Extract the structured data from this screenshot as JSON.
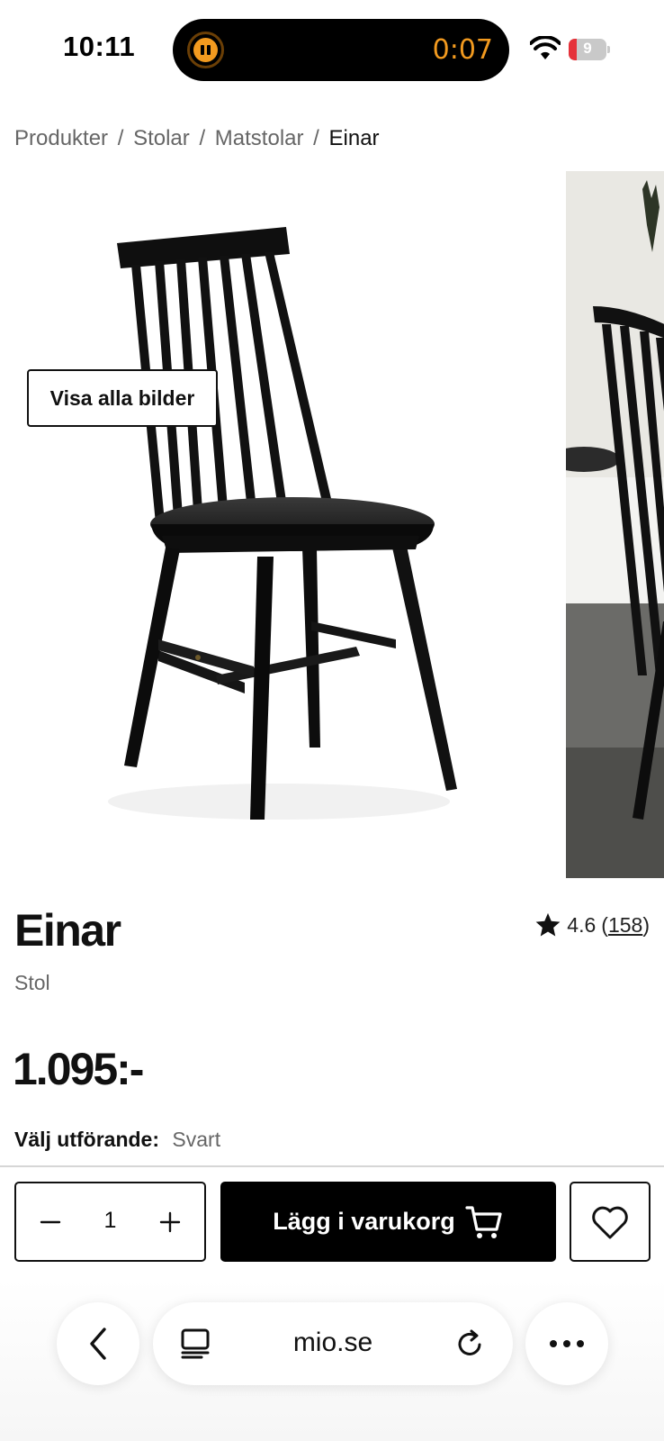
{
  "status_bar": {
    "time": "10:11",
    "timer": "0:07",
    "battery_level": "9",
    "icons": [
      "pause-icon",
      "wifi-icon",
      "battery-icon"
    ],
    "timer_color": "#f29a1f",
    "battery_color": "#e5323a"
  },
  "breadcrumb": {
    "items": [
      "Produkter",
      "Stolar",
      "Matstolar",
      "Einar"
    ],
    "separator": "/"
  },
  "gallery": {
    "show_all_label": "Visa alla bilder"
  },
  "product": {
    "name": "Einar",
    "type": "Stol",
    "rating": "4.6",
    "review_count": "158",
    "rating_open": "(",
    "rating_close": ")",
    "price": "1.095:-",
    "variant_label": "Välj utförande:",
    "variant_value": "Svart"
  },
  "actions": {
    "quantity": "1",
    "add_to_cart_label": "Lägg i varukorg",
    "icons": [
      "minus-icon",
      "plus-icon",
      "cart-icon",
      "heart-icon"
    ]
  },
  "browser": {
    "url": "mio.se",
    "icons": [
      "back-icon",
      "tabs-icon",
      "reload-icon",
      "more-icon"
    ]
  }
}
